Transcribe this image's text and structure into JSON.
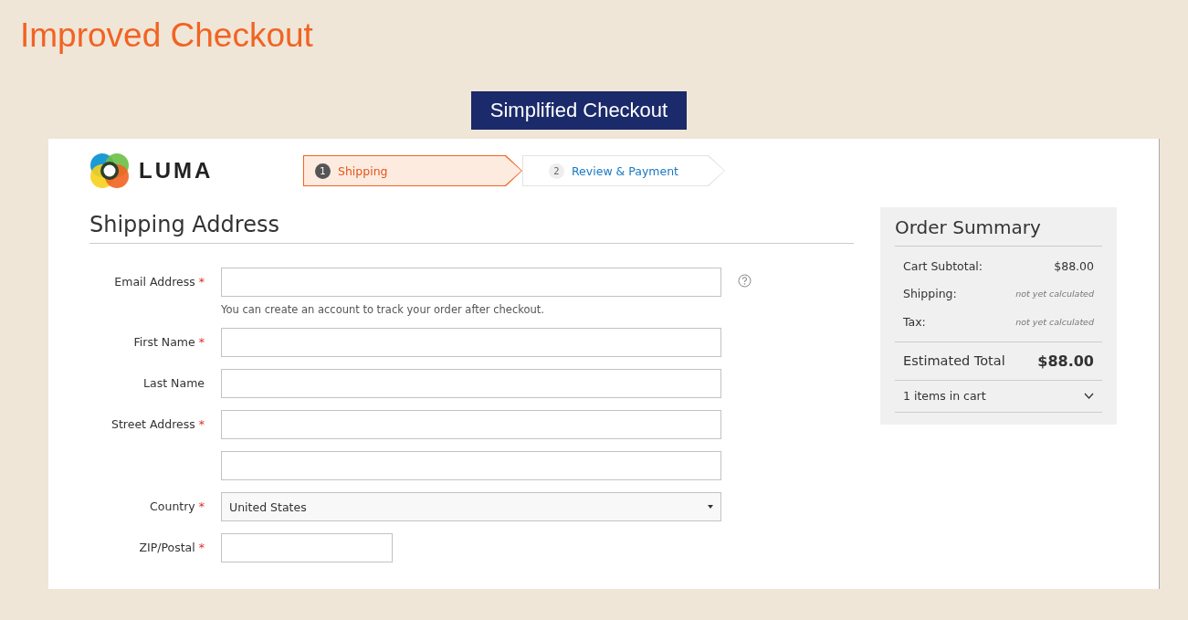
{
  "slide_title": "Improved Checkout",
  "caption": "Simplified Checkout",
  "store": {
    "logo_text": "LUMA"
  },
  "steps": [
    {
      "number": "1",
      "label": "Shipping",
      "selected": true
    },
    {
      "number": "2",
      "label": "Review & Payment",
      "selected": false
    }
  ],
  "heading": "Shipping Address",
  "required_mark": "*",
  "fields": [
    {
      "label": "Email Address",
      "required": true,
      "kind": "text",
      "help": true,
      "note": "You can create an account to track your order after checkout."
    },
    {
      "label": "First Name",
      "required": true,
      "kind": "text"
    },
    {
      "label": "Last Name",
      "required": false,
      "kind": "text"
    },
    {
      "label": "Street Address",
      "required": true,
      "kind": "text"
    },
    {
      "kind": "text"
    },
    {
      "label": "Country",
      "required": true,
      "kind": "select",
      "value": "United States"
    },
    {
      "label": "ZIP/Postal",
      "required": true,
      "kind": "short"
    }
  ],
  "order_summary": {
    "title": "Order Summary",
    "rows": [
      {
        "label": "Cart Subtotal:",
        "value": "$88.00",
        "kind": "amount"
      },
      {
        "label": "Shipping:",
        "value": "not yet calculated",
        "kind": "pending"
      },
      {
        "label": "Tax:",
        "value": "not yet calculated",
        "kind": "pending"
      }
    ],
    "total": {
      "label": "Estimated Total",
      "value": "$88.00"
    },
    "items": {
      "label": "1 items in cart",
      "expanded": false
    }
  }
}
